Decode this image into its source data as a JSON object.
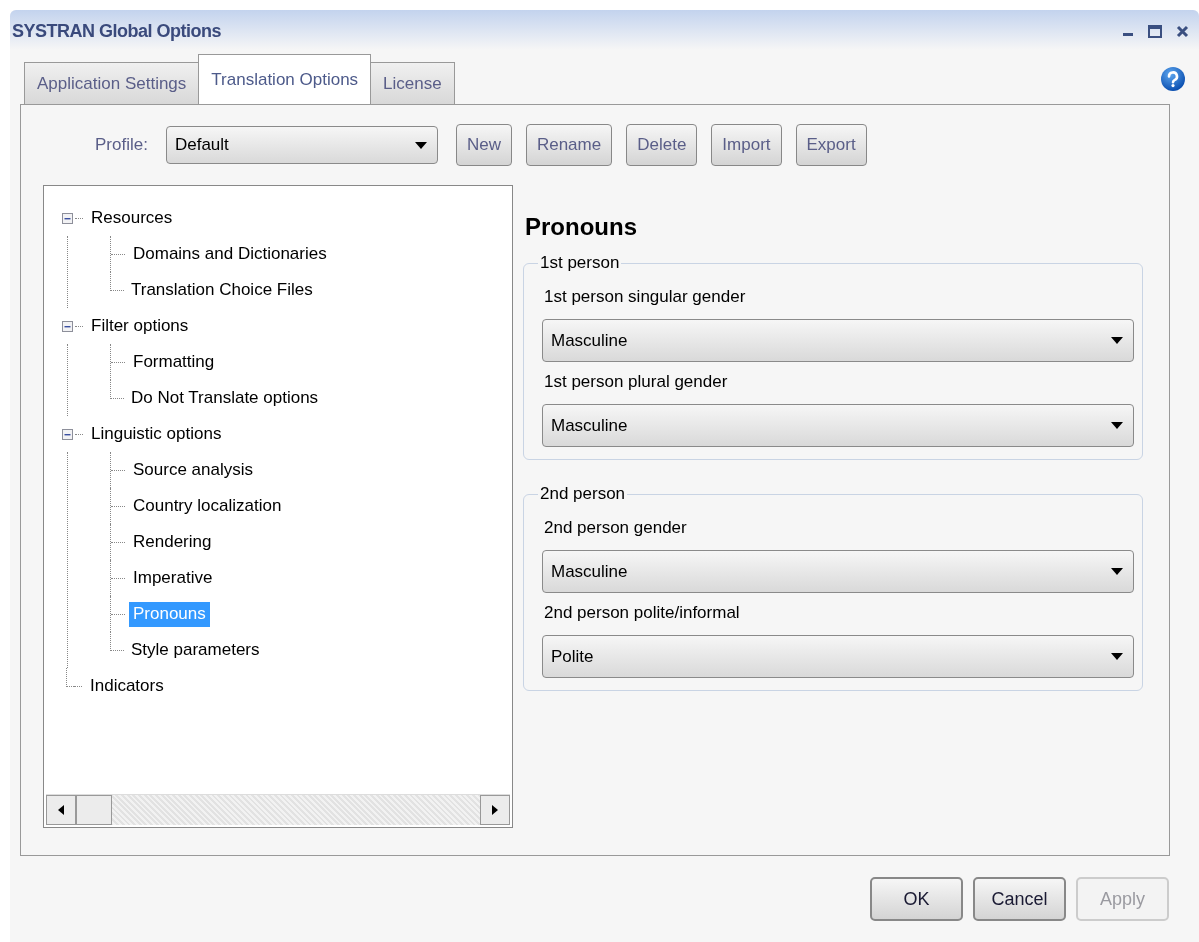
{
  "window": {
    "title": "SYSTRAN Global Options"
  },
  "tabs": [
    {
      "label": "Application Settings",
      "selected": false
    },
    {
      "label": "Translation Options",
      "selected": true
    },
    {
      "label": "License",
      "selected": false
    }
  ],
  "profile": {
    "label": "Profile:",
    "value": "Default"
  },
  "profile_buttons": [
    "New",
    "Rename",
    "Delete",
    "Import",
    "Export"
  ],
  "tree": [
    {
      "label": "Resources",
      "expanded": true,
      "selected": false,
      "children": [
        {
          "label": "Domains and Dictionaries",
          "selected": false
        },
        {
          "label": "Translation Choice Files",
          "selected": false
        }
      ]
    },
    {
      "label": "Filter options",
      "expanded": true,
      "selected": false,
      "children": [
        {
          "label": "Formatting",
          "selected": false
        },
        {
          "label": "Do Not Translate options",
          "selected": false
        }
      ]
    },
    {
      "label": "Linguistic options",
      "expanded": true,
      "selected": false,
      "children": [
        {
          "label": "Source analysis",
          "selected": false
        },
        {
          "label": "Country localization",
          "selected": false
        },
        {
          "label": "Rendering",
          "selected": false
        },
        {
          "label": "Imperative",
          "selected": false
        },
        {
          "label": "Pronouns",
          "selected": true
        },
        {
          "label": "Style parameters",
          "selected": false
        }
      ]
    },
    {
      "label": "Indicators",
      "selected": false
    }
  ],
  "panel": {
    "heading": "Pronouns",
    "groups": [
      {
        "title": "1st person",
        "fields": [
          {
            "label": "1st person singular gender",
            "value": "Masculine"
          },
          {
            "label": "1st person plural gender",
            "value": "Masculine"
          }
        ]
      },
      {
        "title": "2nd person",
        "fields": [
          {
            "label": "2nd person gender",
            "value": "Masculine"
          },
          {
            "label": "2nd person polite/informal",
            "value": "Polite"
          }
        ]
      }
    ]
  },
  "footer_buttons": [
    {
      "label": "OK",
      "disabled": false
    },
    {
      "label": "Cancel",
      "disabled": false
    },
    {
      "label": "Apply",
      "disabled": true
    }
  ]
}
